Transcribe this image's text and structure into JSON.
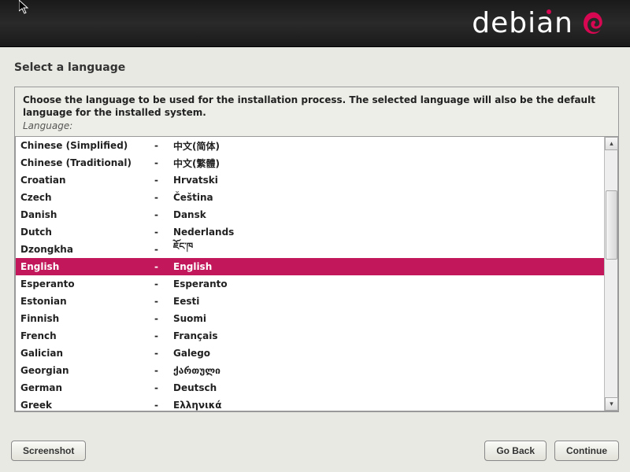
{
  "header": {
    "logo_text": "debian"
  },
  "title": "Select a language",
  "instruction": "Choose the language to be used for the installation process. The selected language will also be the default language for the installed system.",
  "label": "Language:",
  "languages": [
    {
      "name": "Chinese (Simplified)",
      "native": "中文(简体)",
      "selected": false
    },
    {
      "name": "Chinese (Traditional)",
      "native": "中文(繁體)",
      "selected": false
    },
    {
      "name": "Croatian",
      "native": "Hrvatski",
      "selected": false
    },
    {
      "name": "Czech",
      "native": "Čeština",
      "selected": false
    },
    {
      "name": "Danish",
      "native": "Dansk",
      "selected": false
    },
    {
      "name": "Dutch",
      "native": "Nederlands",
      "selected": false
    },
    {
      "name": "Dzongkha",
      "native": "ཇོང་ཁ",
      "selected": false
    },
    {
      "name": "English",
      "native": "English",
      "selected": true
    },
    {
      "name": "Esperanto",
      "native": "Esperanto",
      "selected": false
    },
    {
      "name": "Estonian",
      "native": "Eesti",
      "selected": false
    },
    {
      "name": "Finnish",
      "native": "Suomi",
      "selected": false
    },
    {
      "name": "French",
      "native": "Français",
      "selected": false
    },
    {
      "name": "Galician",
      "native": "Galego",
      "selected": false
    },
    {
      "name": "Georgian",
      "native": "ქართული",
      "selected": false
    },
    {
      "name": "German",
      "native": "Deutsch",
      "selected": false
    },
    {
      "name": "Greek",
      "native": "Ελληνικά",
      "selected": false
    }
  ],
  "separator": "-",
  "buttons": {
    "screenshot": "Screenshot",
    "go_back": "Go Back",
    "continue": "Continue"
  }
}
